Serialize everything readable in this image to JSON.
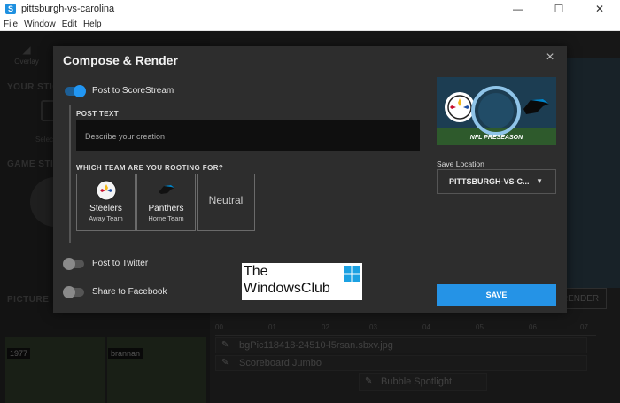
{
  "window": {
    "title": "pittsburgh-vs-carolina",
    "app_icon": "S",
    "minimize": "—",
    "maximize": "☐",
    "close": "✕"
  },
  "menu": [
    "File",
    "Window",
    "Edit",
    "Help"
  ],
  "background": {
    "overlay_label": "Overlay",
    "your_stickers_label": "YOUR STIC",
    "select_label": "Selec",
    "game_stickers_label": "GAME STIC",
    "picture_label": "PICTURE",
    "tile_labels": [
      "1977",
      "brannan"
    ],
    "render_label": "RENDER",
    "timeline_ticks": [
      "00",
      "01",
      "02",
      "03",
      "04",
      "05",
      "06",
      "07"
    ],
    "tracks": [
      "bgPic118418-24510-l5rsan.sbxv.jpg",
      "Scoreboard Jumbo"
    ],
    "chip": "Bubble Spotlight"
  },
  "modal": {
    "title": "Compose & Render",
    "close_icon": "×",
    "post_scorestream": {
      "label": "Post to ScoreStream",
      "on": true
    },
    "post_text_label": "POST TEXT",
    "post_text_placeholder": "Describe your creation",
    "post_text_value": "",
    "rooting_label": "WHICH TEAM ARE YOU ROOTING FOR?",
    "teams": [
      {
        "name": "Steelers",
        "sub": "Away Team"
      },
      {
        "name": "Panthers",
        "sub": "Home Team"
      },
      {
        "name": "Neutral",
        "sub": ""
      }
    ],
    "post_twitter": {
      "label": "Post to Twitter",
      "on": false
    },
    "share_facebook": {
      "label": "Share to Facebook",
      "on": false
    },
    "preview": {
      "left_team": "Steelers",
      "right_team": "PANTHERS",
      "caption": "NFL PRESEASON"
    },
    "save_location_label": "Save Location",
    "save_location_value": "PITTSBURGH-VS-C...",
    "save_label": "SAVE"
  },
  "watermark": {
    "line1": "The",
    "line2": "WindowsClub"
  },
  "colors": {
    "accent": "#2593e6",
    "modal_bg": "#2d2d2d",
    "field_bg": "#0f0f0f"
  }
}
